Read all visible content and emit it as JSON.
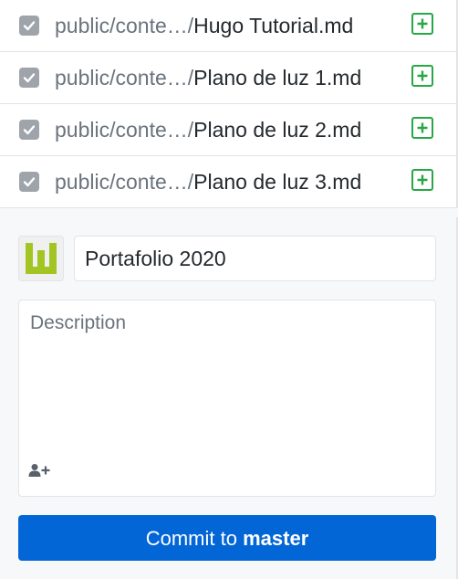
{
  "changed_files": [
    {
      "checked": true,
      "dir": "public/conte…/",
      "filename": "Hugo Tutorial.md",
      "status": "added"
    },
    {
      "checked": true,
      "dir": "public/conte…/",
      "filename": "Plano de luz 1.md",
      "status": "added"
    },
    {
      "checked": true,
      "dir": "public/conte…/",
      "filename": "Plano de luz 2.md",
      "status": "added"
    },
    {
      "checked": true,
      "dir": "public/conte…/",
      "filename": "Plano de luz 3.md",
      "status": "added"
    }
  ],
  "commit": {
    "summary_value": "Portafolio 2020",
    "description_placeholder": "Description",
    "button_prefix": "Commit to ",
    "branch": "master"
  },
  "colors": {
    "checkbox": "#9ea4aa",
    "added": "#28a745",
    "button": "#0366d6",
    "avatar": "#a2c523"
  },
  "icons": {
    "checkbox": "checkmark-icon",
    "status": "diff-added-icon",
    "coauthor": "add-person-icon",
    "avatar": "avatar-identicon"
  }
}
